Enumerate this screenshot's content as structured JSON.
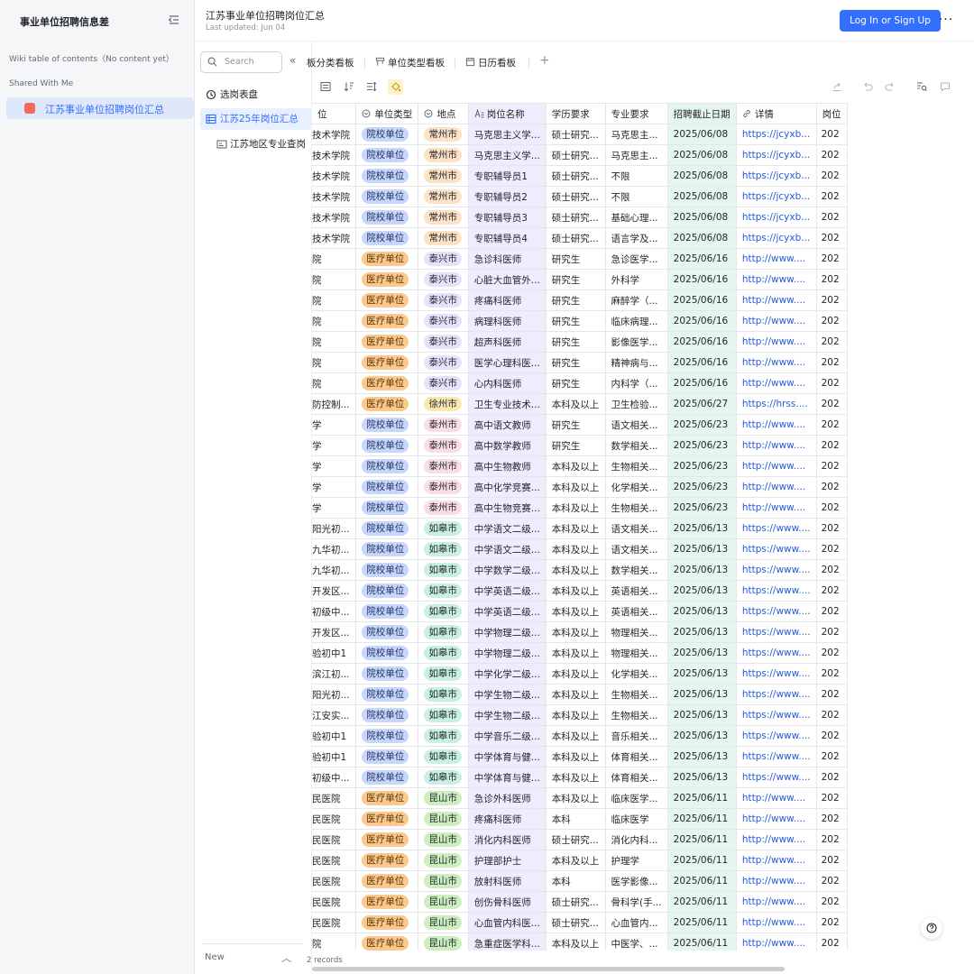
{
  "wiki": {
    "title": "事业单位招聘信息差",
    "toc_label": "Wiki table of contents（No content yet）",
    "shared_label": "Shared With Me",
    "shared_item": "江苏事业单位招聘岗位汇总"
  },
  "header": {
    "title": "江苏事业单位招聘岗位汇总",
    "updated": "Last updated: Jun 04",
    "login_label": "Log In or Sign Up",
    "more_glyph": "···"
  },
  "views": {
    "search_placeholder": "Search",
    "items": [
      {
        "label": "选岗表盘",
        "icon": "dashboard-icon"
      },
      {
        "label": "江苏25年岗位汇总",
        "icon": "grid-table-icon"
      },
      {
        "label": "江苏地区专业查岗",
        "icon": "form-icon"
      }
    ],
    "new_label": "New"
  },
  "tabs": [
    "板分类看板",
    "单位类型看板",
    "日历看板"
  ],
  "records_label": "2 records",
  "columns": [
    "位",
    "单位类型",
    "地点",
    "岗位名称",
    "学历要求",
    "专业要求",
    "招聘截止日期",
    "详情",
    "岗位"
  ],
  "column_icons": [
    "",
    "single-select-icon",
    "single-select-icon",
    "text-icon",
    "",
    "",
    "",
    "link-icon",
    ""
  ],
  "location_colors": {
    "常州市": "#fde2c5",
    "泰兴市": "#e7e2fb",
    "徐州市": "#fbeab0",
    "泰州市": "#fbdde4",
    "如皋市": "#c9f0e2",
    "昆山市": "#cdefc0"
  },
  "rows": [
    [
      "技术学院",
      "院校单位",
      "常州市",
      "马克思主义学...",
      "硕士研究...",
      "马克思主...",
      "2025/06/08",
      "https://jcyxb...",
      "202"
    ],
    [
      "技术学院",
      "院校单位",
      "常州市",
      "马克思主义学...",
      "硕士研究...",
      "马克思主...",
      "2025/06/08",
      "https://jcyxb...",
      "202"
    ],
    [
      "技术学院",
      "院校单位",
      "常州市",
      "专职辅导员1",
      "硕士研究...",
      "不限",
      "2025/06/08",
      "https://jcyxb...",
      "202"
    ],
    [
      "技术学院",
      "院校单位",
      "常州市",
      "专职辅导员2",
      "硕士研究...",
      "不限",
      "2025/06/08",
      "https://jcyxb...",
      "202"
    ],
    [
      "技术学院",
      "院校单位",
      "常州市",
      "专职辅导员3",
      "硕士研究...",
      "基础心理...",
      "2025/06/08",
      "https://jcyxb...",
      "202"
    ],
    [
      "技术学院",
      "院校单位",
      "常州市",
      "专职辅导员4",
      "硕士研究...",
      "语言学及...",
      "2025/06/08",
      "https://jcyxb...",
      "202"
    ],
    [
      "院",
      "医疗单位",
      "泰兴市",
      "急诊科医师",
      "研究生",
      "急诊医学...",
      "2025/06/16",
      "http://www....",
      "202"
    ],
    [
      "院",
      "医疗单位",
      "泰兴市",
      "心脏大血管外...",
      "研究生",
      "外科学",
      "2025/06/16",
      "http://www....",
      "202"
    ],
    [
      "院",
      "医疗单位",
      "泰兴市",
      "疼痛科医师",
      "研究生",
      "麻醉学（...",
      "2025/06/16",
      "http://www....",
      "202"
    ],
    [
      "院",
      "医疗单位",
      "泰兴市",
      "病理科医师",
      "研究生",
      "临床病理...",
      "2025/06/16",
      "http://www....",
      "202"
    ],
    [
      "院",
      "医疗单位",
      "泰兴市",
      "超声科医师",
      "研究生",
      "影像医学...",
      "2025/06/16",
      "http://www....",
      "202"
    ],
    [
      "院",
      "医疗单位",
      "泰兴市",
      "医学心理科医...",
      "研究生",
      "精神病与...",
      "2025/06/16",
      "http://www....",
      "202"
    ],
    [
      "院",
      "医疗单位",
      "泰兴市",
      "心内科医师",
      "研究生",
      "内科学（...",
      "2025/06/16",
      "http://www....",
      "202"
    ],
    [
      "防控制...",
      "医疗单位",
      "徐州市",
      "卫生专业技术...",
      "本科及以上",
      "卫生检验...",
      "2025/06/27",
      "https://hrss....",
      "202"
    ],
    [
      "学",
      "院校单位",
      "泰州市",
      "高中语文教师",
      "研究生",
      "语文相关...",
      "2025/06/23",
      "http://www....",
      "202"
    ],
    [
      "学",
      "院校单位",
      "泰州市",
      "高中数学教师",
      "研究生",
      "数学相关...",
      "2025/06/23",
      "http://www....",
      "202"
    ],
    [
      "学",
      "院校单位",
      "泰州市",
      "高中生物教师",
      "本科及以上",
      "生物相关...",
      "2025/06/23",
      "http://www....",
      "202"
    ],
    [
      "学",
      "院校单位",
      "泰州市",
      "高中化学竞赛...",
      "本科及以上",
      "化学相关...",
      "2025/06/23",
      "http://www....",
      "202"
    ],
    [
      "学",
      "院校单位",
      "泰州市",
      "高中生物竞赛...",
      "本科及以上",
      "生物相关...",
      "2025/06/23",
      "http://www....",
      "202"
    ],
    [
      "阳光初...",
      "院校单位",
      "如皋市",
      "中学语文二级...",
      "本科及以上",
      "语文相关...",
      "2025/06/13",
      "https://www....",
      "202"
    ],
    [
      "九华初...",
      "院校单位",
      "如皋市",
      "中学语文二级...",
      "本科及以上",
      "语文相关...",
      "2025/06/13",
      "https://www....",
      "202"
    ],
    [
      "九华初...",
      "院校单位",
      "如皋市",
      "中学数学二级...",
      "本科及以上",
      "数学相关...",
      "2025/06/13",
      "https://www....",
      "202"
    ],
    [
      "开发区...",
      "院校单位",
      "如皋市",
      "中学英语二级...",
      "本科及以上",
      "英语相关...",
      "2025/06/13",
      "https://www....",
      "202"
    ],
    [
      "初级中...",
      "院校单位",
      "如皋市",
      "中学英语二级...",
      "本科及以上",
      "英语相关...",
      "2025/06/13",
      "https://www....",
      "202"
    ],
    [
      "开发区...",
      "院校单位",
      "如皋市",
      "中学物理二级...",
      "本科及以上",
      "物理相关...",
      "2025/06/13",
      "https://www....",
      "202"
    ],
    [
      "验初中1",
      "院校单位",
      "如皋市",
      "中学物理二级...",
      "本科及以上",
      "物理相关...",
      "2025/06/13",
      "https://www....",
      "202"
    ],
    [
      "滨江初...",
      "院校单位",
      "如皋市",
      "中学化学二级...",
      "本科及以上",
      "化学相关...",
      "2025/06/13",
      "https://www....",
      "202"
    ],
    [
      "阳光初...",
      "院校单位",
      "如皋市",
      "中学生物二级...",
      "本科及以上",
      "生物相关...",
      "2025/06/13",
      "https://www....",
      "202"
    ],
    [
      "江安实...",
      "院校单位",
      "如皋市",
      "中学生物二级...",
      "本科及以上",
      "生物相关...",
      "2025/06/13",
      "https://www....",
      "202"
    ],
    [
      "验初中1",
      "院校单位",
      "如皋市",
      "中学音乐二级...",
      "本科及以上",
      "音乐相关...",
      "2025/06/13",
      "https://www....",
      "202"
    ],
    [
      "验初中1",
      "院校单位",
      "如皋市",
      "中学体育与健...",
      "本科及以上",
      "体育相关...",
      "2025/06/13",
      "https://www....",
      "202"
    ],
    [
      "初级中...",
      "院校单位",
      "如皋市",
      "中学体育与健...",
      "本科及以上",
      "体育相关...",
      "2025/06/13",
      "https://www....",
      "202"
    ],
    [
      "民医院",
      "医疗单位",
      "昆山市",
      "急诊外科医师",
      "本科及以上",
      "临床医学...",
      "2025/06/11",
      "http://www....",
      "202"
    ],
    [
      "民医院",
      "医疗单位",
      "昆山市",
      "疼痛科医师",
      "本科",
      "临床医学",
      "2025/06/11",
      "http://www....",
      "202"
    ],
    [
      "民医院",
      "医疗单位",
      "昆山市",
      "消化内科医师",
      "硕士研究...",
      "消化内科...",
      "2025/06/11",
      "http://www....",
      "202"
    ],
    [
      "民医院",
      "医疗单位",
      "昆山市",
      "护理部护士",
      "本科及以上",
      "护理学",
      "2025/06/11",
      "http://www....",
      "202"
    ],
    [
      "民医院",
      "医疗单位",
      "昆山市",
      "放射科医师",
      "本科",
      "医学影像...",
      "2025/06/11",
      "http://www....",
      "202"
    ],
    [
      "民医院",
      "医疗单位",
      "昆山市",
      "创伤骨科医师",
      "硕士研究...",
      "骨科学(手...",
      "2025/06/11",
      "http://www....",
      "202"
    ],
    [
      "民医院",
      "医疗单位",
      "昆山市",
      "心血管内科医...",
      "硕士研究...",
      "心血管内...",
      "2025/06/11",
      "http://www....",
      "202"
    ],
    [
      "院",
      "医疗单位",
      "昆山市",
      "急重症医学科...",
      "本科及以上",
      "中医学、...",
      "2025/06/11",
      "http://www....",
      "202"
    ]
  ]
}
